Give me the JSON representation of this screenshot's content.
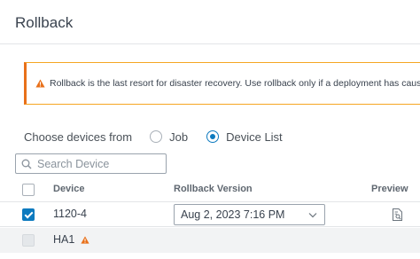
{
  "header": {
    "title": "Rollback"
  },
  "warning": {
    "text": "Rollback is the last resort for disaster recovery. Use rollback only if a deployment has caused a d",
    "color": "#e8701a"
  },
  "choose": {
    "label": "Choose devices from",
    "options": [
      {
        "label": "Job",
        "selected": false
      },
      {
        "label": "Device List",
        "selected": true
      }
    ]
  },
  "search": {
    "placeholder": "Search Device"
  },
  "table": {
    "columns": {
      "device": "Device",
      "version": "Rollback Version",
      "preview": "Preview"
    },
    "rows": [
      {
        "device": "1120-4",
        "version": "Aug 2, 2023 7:16 PM",
        "checked": true
      },
      {
        "device": "HA1",
        "version": "",
        "checked": false,
        "disabled": true,
        "warning": true
      }
    ]
  },
  "colors": {
    "accent": "#0d7abf",
    "warning": "#f5a623"
  }
}
